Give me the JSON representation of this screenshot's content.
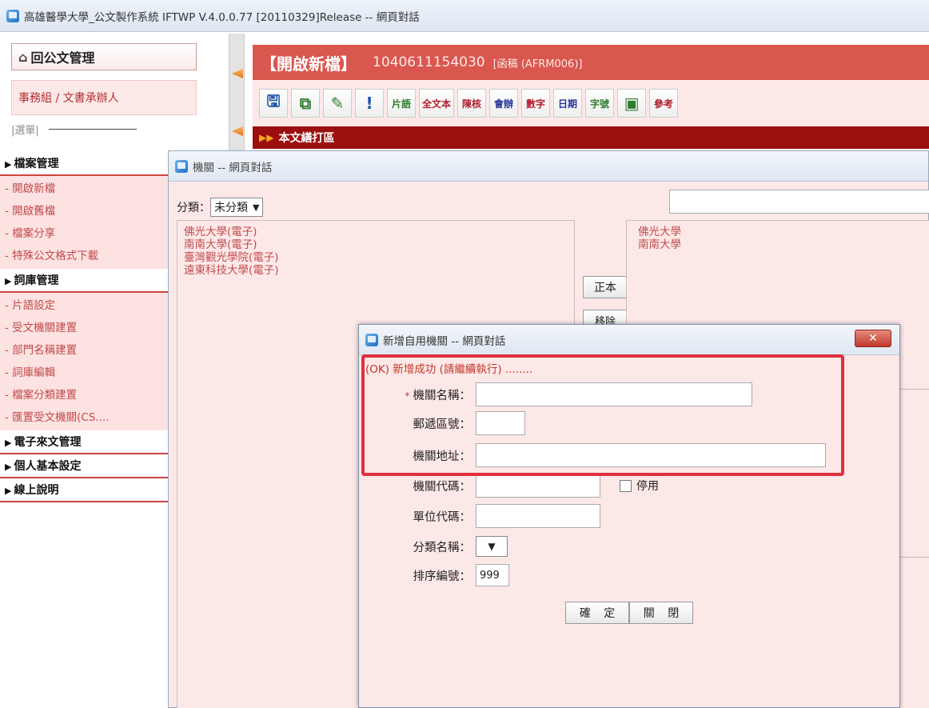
{
  "window": {
    "title": "高雄醫學大學_公文製作系統 IFTWP V.4.0.0.77 [20110329]Release -- 網頁對話"
  },
  "left": {
    "logo_text": "回公文管理",
    "role": "事務組 / 文書承辦人",
    "menu_label": "|選單|",
    "groups": [
      {
        "label": "檔案管理",
        "items": [
          "- 開啟新檔",
          "- 開啟舊檔",
          "- 檔案分享",
          "- 特殊公文格式下載"
        ]
      },
      {
        "label": "詞庫管理",
        "items": [
          "- 片語設定",
          "- 受文機關建置",
          "- 部門名稱建置",
          "- 詞庫編輯",
          "- 檔案分類建置",
          "- 匯置受文機關(CS...."
        ]
      },
      {
        "label": "電子來文管理",
        "items": []
      },
      {
        "label": "個人基本設定",
        "items": []
      },
      {
        "label": "線上說明",
        "items": []
      }
    ]
  },
  "main": {
    "action": "【開啟新檔】",
    "doc_id": "1040611154030",
    "doc_type": "[函稿 (AFRM006)]",
    "toolbar": [
      "片語",
      "全文本",
      "陳核",
      "會辦",
      "數字",
      "日期",
      "字號",
      "參考"
    ],
    "strip": "本文繕打區"
  },
  "dialog1": {
    "title": "機關 -- 網頁對話",
    "category_label": "分類：",
    "category_value": "未分類",
    "left_list": [
      "佛光大學(電子)",
      "南南大學(電子)",
      "臺灣觀光學院(電子)",
      "遠東科技大學(電子)"
    ],
    "right_list": [
      "佛光大學",
      "南南大學"
    ],
    "btn_main": "正本",
    "btn_remove": "移除"
  },
  "dialog2": {
    "title": "新增自用機關 -- 網頁對話",
    "close": "✕",
    "status": "(OK) 新增成功 (請繼續執行) ........",
    "required_mark": "*",
    "fields": {
      "name_label": "機關名稱：",
      "zip_label": "郵遞區號：",
      "address_label": "機關地址：",
      "code_label": "機關代碼：",
      "disable_label": "停用",
      "unit_label": "單位代碼：",
      "category_label": "分類名稱：",
      "sort_label": "排序編號：",
      "sort_value": "999"
    },
    "ok_button": "確 定",
    "close_button": "關 閉"
  },
  "colors": {
    "accent": "#d9574f",
    "strip": "#9c0f0f",
    "panel_bg": "#fde8e8",
    "highlight": "#e03040"
  }
}
